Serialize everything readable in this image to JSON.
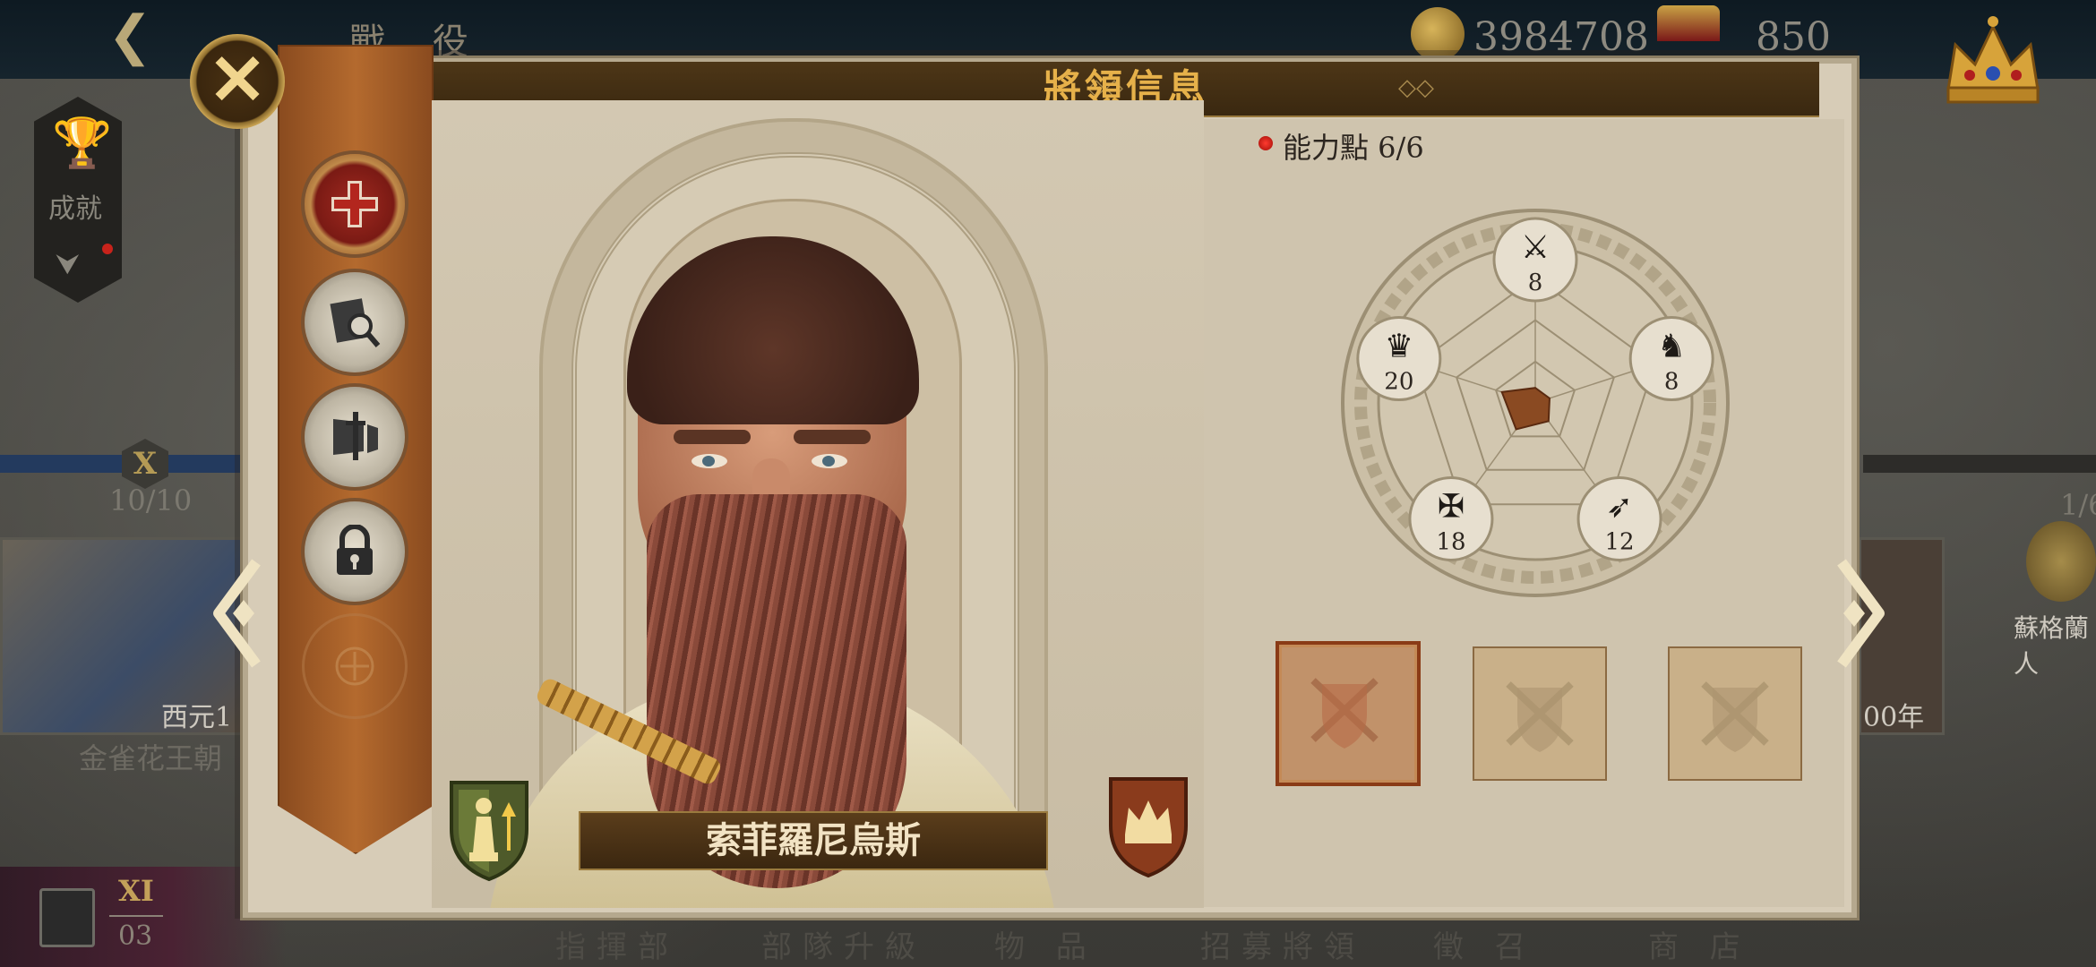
{
  "background": {
    "top_title": "戰 役",
    "coins": "3984708",
    "second_value": "850",
    "achievements_label": "成就",
    "level_badge": "X",
    "count_left": "10/10",
    "card_left_year": "西元1",
    "card_left_name": "金雀花王朝",
    "count_right": "1/6",
    "card_right_year": "00年",
    "card_right_name": "蘇格蘭人",
    "chapter_roman": "XI",
    "chapter_number": "03",
    "bottom_tabs": [
      "指揮部",
      "部隊升級",
      "物 品",
      "招募將領",
      "徵 召",
      "商 店"
    ]
  },
  "modal": {
    "title": "將領信息",
    "general_name": "索菲羅尼烏斯",
    "ability_points_label": "能力點 6/6",
    "sidebar_items": [
      {
        "name": "medical",
        "icon": "red-cross-icon",
        "active": true
      },
      {
        "name": "inspect",
        "icon": "magnifier-map-icon",
        "active": false
      },
      {
        "name": "equipment",
        "icon": "sword-banner-icon",
        "active": false
      },
      {
        "name": "locked",
        "icon": "padlock-icon",
        "active": false
      },
      {
        "name": "empty",
        "icon": "ornament-icon",
        "active": false
      }
    ],
    "stats": [
      {
        "icon": "crossed-swords-icon",
        "value": "8"
      },
      {
        "icon": "horse-icon",
        "value": "8"
      },
      {
        "icon": "bow-icon",
        "value": "12"
      },
      {
        "icon": "eagle-icon",
        "value": "18"
      },
      {
        "icon": "crown-icon",
        "value": "20"
      }
    ],
    "stat_radar_fraction": [
      0.12,
      0.12,
      0.18,
      0.26,
      0.28
    ],
    "equipment_slots": 3
  },
  "colors": {
    "header_gold": "#e6b14a",
    "parchment": "#d7ccb7",
    "sidebar_orange": "#b46a2e",
    "active_red": "#a12a20",
    "radar_fill": "#8a4a22"
  }
}
